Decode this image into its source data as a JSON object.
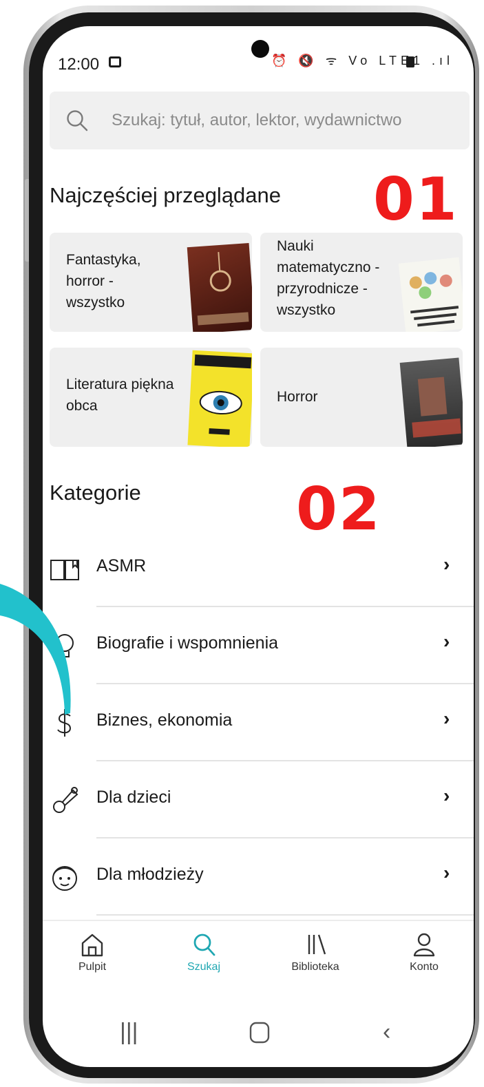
{
  "status_bar": {
    "time": "12:00",
    "network_icons": "⏰ 🔇 ᯤ Vo LTE1 .ıl"
  },
  "search": {
    "placeholder": "Szukaj: tytuł, autor, lektor, wydawnictwo",
    "icon": "search-icon"
  },
  "most_viewed": {
    "title": "Najczęściej przeglądane",
    "tiles": [
      {
        "label": "Fantastyka, horror - wszystko"
      },
      {
        "label": "Nauki matematyczno -przyrodnicze - wszystko"
      },
      {
        "label": "Literatura piękna obca"
      },
      {
        "label": "Horror"
      }
    ]
  },
  "categories": {
    "title": "Kategorie",
    "items": [
      {
        "label": "ASMR",
        "icon": "book-icon"
      },
      {
        "label": "Biografie i wspomnienia",
        "icon": "bulb-icon"
      },
      {
        "label": "Biznes, ekonomia",
        "icon": "dollar-icon"
      },
      {
        "label": "Dla dzieci",
        "icon": "toy-icon"
      },
      {
        "label": "Dla młodzieży",
        "icon": "teen-face-icon"
      }
    ]
  },
  "bottom_nav": {
    "items": [
      {
        "label": "Pulpit",
        "icon": "home-icon",
        "active": false
      },
      {
        "label": "Szukaj",
        "icon": "search-icon",
        "active": true
      },
      {
        "label": "Biblioteka",
        "icon": "library-icon",
        "active": false
      },
      {
        "label": "Konto",
        "icon": "account-icon",
        "active": false
      }
    ]
  },
  "annotations": {
    "label_1": "01",
    "label_2": "02"
  },
  "colors": {
    "accent": "#1fa7b2",
    "annotation_red": "#ee1c1c",
    "teal_arc": "#22c1cc",
    "tile_bg": "#efefef"
  }
}
